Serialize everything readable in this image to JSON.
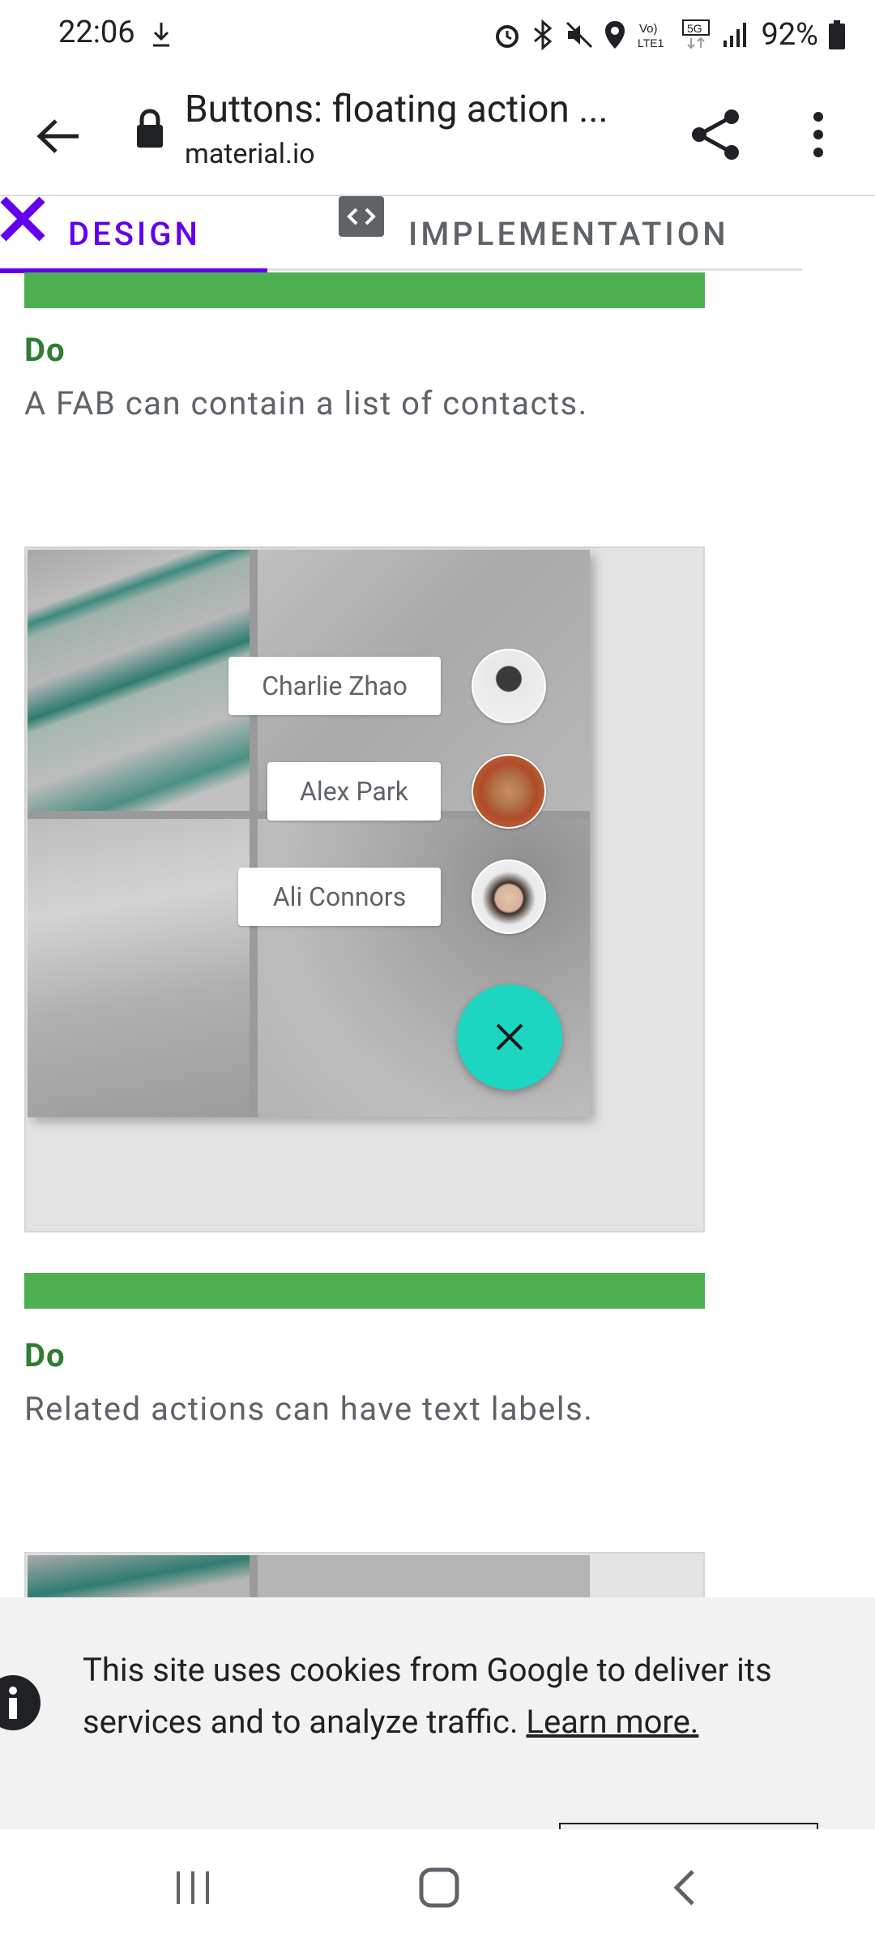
{
  "status_bar": {
    "time": "22:06",
    "battery": "92%",
    "network_volte": "Vo) LTE1",
    "network_5g": "5G"
  },
  "app_bar": {
    "title": "Buttons: floating action ...",
    "url": "material.io"
  },
  "tabs": [
    {
      "label": "DESIGN",
      "active": true,
      "icon": "design-tools-icon"
    },
    {
      "label": "IMPLEMENTATION",
      "active": false,
      "icon": "code-icon"
    }
  ],
  "content": {
    "section1": {
      "do_label": "Do",
      "caption": "A FAB can contain a list of contacts."
    },
    "example": {
      "contacts": [
        "Charlie Zhao",
        "Alex Park",
        "Ali Connors"
      ],
      "fab_icon": "close-icon"
    },
    "section2": {
      "do_label": "Do",
      "caption": "Related actions can have text labels."
    }
  },
  "cookie_banner": {
    "text": "This site uses cookies from Google to deliver its services and to analyze traffic.",
    "link": "Learn more."
  },
  "colors": {
    "accent": "#6200ee",
    "do_green": "#4caf50",
    "do_text": "#2e7d32",
    "fab": "#1dd6c2"
  }
}
